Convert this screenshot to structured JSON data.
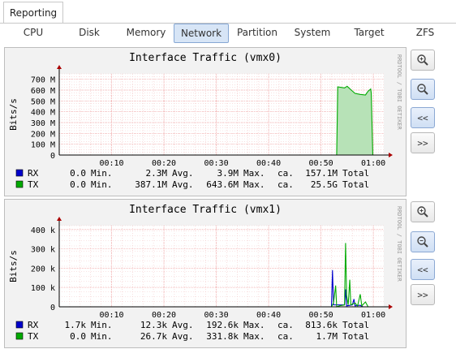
{
  "top_tab": {
    "label": "Reporting"
  },
  "subtabs": [
    {
      "label": "CPU"
    },
    {
      "label": "Disk"
    },
    {
      "label": "Memory"
    },
    {
      "label": "Network",
      "active": true
    },
    {
      "label": "Partition"
    },
    {
      "label": "System"
    },
    {
      "label": "Target"
    },
    {
      "label": "ZFS"
    }
  ],
  "side_buttons": [
    {
      "icon": "zoom-in-icon",
      "label": ""
    },
    {
      "icon": "zoom-out-icon",
      "label": ""
    },
    {
      "icon": "back-icon",
      "label": "<<"
    },
    {
      "icon": "forward-icon",
      "label": ">>"
    }
  ],
  "colors": {
    "rx": "#0000cc",
    "tx": "#00aa00",
    "tx_fill": "#b7e2b7",
    "grid": "#f0a0a0",
    "axis": "#000000"
  },
  "watermark": "RRDTOOL / TOBI OETIKER",
  "chart_data": [
    {
      "type": "area",
      "title": "Interface Traffic (vmx0)",
      "ylabel": "Bits/s",
      "y_ticks": [
        "0",
        "100 M",
        "200 M",
        "300 M",
        "400 M",
        "500 M",
        "600 M",
        "700 M"
      ],
      "ylim": [
        0,
        750000000
      ],
      "x_ticks": [
        "00:10",
        "00:20",
        "00:30",
        "00:40",
        "00:50",
        "01:00"
      ],
      "xlim_minutes": [
        0,
        62
      ],
      "series": [
        {
          "name": "RX",
          "color": "#0000cc",
          "points": [
            [
              53.2,
              0
            ],
            [
              53.3,
              2000000
            ],
            [
              56,
              3000000
            ],
            [
              59.5,
              2500000
            ],
            [
              59.6,
              0
            ]
          ],
          "stats": {
            "min": "0.0",
            "avg": "2.3M",
            "max": "3.9M",
            "total": "157.1M"
          }
        },
        {
          "name": "TX",
          "color": "#00aa00",
          "fill": true,
          "points": [
            [
              53.0,
              0
            ],
            [
              53.2,
              630000000
            ],
            [
              54.5,
              620000000
            ],
            [
              55,
              635000000
            ],
            [
              55.8,
              600000000
            ],
            [
              56.5,
              570000000
            ],
            [
              57.5,
              560000000
            ],
            [
              58.5,
              555000000
            ],
            [
              59,
              590000000
            ],
            [
              59.5,
              610000000
            ],
            [
              59.6,
              575000000
            ],
            [
              59.9,
              0
            ]
          ],
          "stats": {
            "min": "0.0",
            "avg": "387.1M",
            "max": "643.6M",
            "total": "25.5G"
          }
        }
      ],
      "stat_labels": {
        "min": "Min.",
        "avg": "Avg.",
        "max": "Max.",
        "total_prefix": "ca.",
        "total": "Total"
      }
    },
    {
      "type": "line",
      "title": "Interface Traffic (vmx1)",
      "ylabel": "Bits/s",
      "y_ticks": [
        "0",
        "100 k",
        "200 k",
        "300 k",
        "400 k"
      ],
      "ylim": [
        0,
        420000
      ],
      "x_ticks": [
        "00:10",
        "00:20",
        "00:30",
        "00:40",
        "00:50",
        "01:00"
      ],
      "xlim_minutes": [
        0,
        62
      ],
      "series": [
        {
          "name": "RX",
          "color": "#0000cc",
          "points": [
            [
              52.0,
              0
            ],
            [
              52.2,
              190000
            ],
            [
              52.4,
              10000
            ],
            [
              54.5,
              10000
            ],
            [
              54.7,
              90000
            ],
            [
              54.9,
              5000
            ],
            [
              56,
              10000
            ],
            [
              56.3,
              40000
            ],
            [
              56.5,
              5000
            ],
            [
              57.5,
              8000
            ],
            [
              58,
              0
            ]
          ],
          "stats": {
            "min": "1.7k",
            "avg": "12.3k",
            "max": "192.6k",
            "total": "813.6k"
          }
        },
        {
          "name": "TX",
          "color": "#00aa00",
          "points": [
            [
              52.0,
              0
            ],
            [
              52.4,
              20000
            ],
            [
              52.8,
              110000
            ],
            [
              53.0,
              0
            ],
            [
              53.5,
              5000
            ],
            [
              54.5,
              10000
            ],
            [
              54.7,
              330000
            ],
            [
              54.9,
              60000
            ],
            [
              55.2,
              10000
            ],
            [
              55.5,
              140000
            ],
            [
              55.7,
              10000
            ],
            [
              56.5,
              20000
            ],
            [
              57.0,
              5000
            ],
            [
              57.5,
              65000
            ],
            [
              57.8,
              5000
            ],
            [
              58.5,
              25000
            ],
            [
              59,
              0
            ]
          ],
          "stats": {
            "min": "0.0",
            "avg": "26.7k",
            "max": "331.8k",
            "total": "1.7M"
          }
        }
      ],
      "stat_labels": {
        "min": "Min.",
        "avg": "Avg.",
        "max": "Max.",
        "total_prefix": "ca.",
        "total": "Total"
      }
    }
  ]
}
